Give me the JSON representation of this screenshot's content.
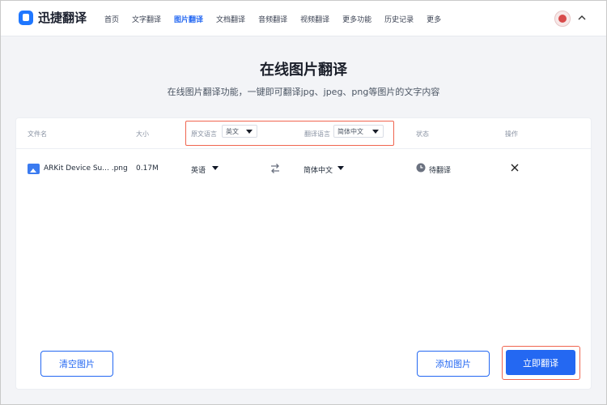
{
  "app": {
    "logo_text": "迅捷翻译"
  },
  "nav": {
    "items": [
      {
        "label": "首页"
      },
      {
        "label": "文字翻译"
      },
      {
        "label": "图片翻译"
      },
      {
        "label": "文档翻译"
      },
      {
        "label": "音频翻译"
      },
      {
        "label": "视频翻译"
      },
      {
        "label": "更多功能"
      },
      {
        "label": "历史记录"
      },
      {
        "label": "更多"
      }
    ],
    "active_index": 2
  },
  "hero": {
    "title": "在线图片翻译",
    "subtitle": "在线图片翻译功能，一键即可翻译jpg、jpeg、png等图片的文字内容"
  },
  "table": {
    "headers": {
      "filename": "文件名",
      "size": "大小",
      "source_lang_label": "原文语言",
      "source_lang_value": "英文",
      "target_lang_label": "翻译语言",
      "target_lang_value": "简体中文",
      "status": "状态",
      "action": "操作"
    },
    "rows": [
      {
        "filename": "ARKit Device Su... .png",
        "size": "0.17M",
        "source_lang": "英语",
        "target_lang": "简体中文",
        "status": "待翻译"
      }
    ]
  },
  "buttons": {
    "clear": "清空图片",
    "add": "添加图片",
    "translate": "立即翻译"
  },
  "colors": {
    "accent": "#2468f2",
    "highlight_box": "#f0654f"
  }
}
